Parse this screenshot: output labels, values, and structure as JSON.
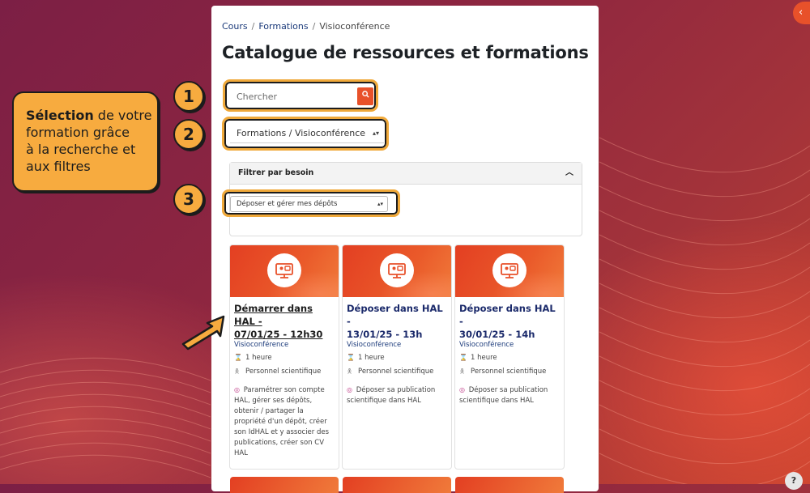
{
  "breadcrumb": {
    "items": [
      "Cours",
      "Formations",
      "Visioconférence"
    ]
  },
  "page_title": "Catalogue de ressources et formations",
  "search": {
    "placeholder": "Chercher",
    "button_icon": "search-icon"
  },
  "category_select": {
    "value": "Formations / Visioconférence"
  },
  "filter": {
    "header": "Filtrer par besoin",
    "selected": "Déposer et gérer mes dépôts"
  },
  "callout": {
    "bold": "Sélection",
    "line1_rest": " de votre",
    "line2": "formation grâce",
    "line3": "à la recherche et",
    "line4": "aux filtres"
  },
  "steps": [
    "1",
    "2",
    "3"
  ],
  "cards": [
    {
      "title_line1": "Démarrer dans HAL -",
      "title_line2": "07/01/25 - 12h30",
      "category": "Visioconférence",
      "duration": "1 heure",
      "audience": "Personnel scientifique",
      "description": "Paramétrer son compte HAL, gérer ses dépôts, obtenir / partager la propriété d'un dépôt, créer son IdHAL et y associer des publications, créer son CV HAL"
    },
    {
      "title_line1": "Déposer dans HAL -",
      "title_line2": "13/01/25 - 13h",
      "category": "Visioconférence",
      "duration": "1 heure",
      "audience": "Personnel scientifique",
      "description": "Déposer sa publication scientifique dans HAL"
    },
    {
      "title_line1": "Déposer dans HAL -",
      "title_line2": "30/01/25 - 14h",
      "category": "Visioconférence",
      "duration": "1 heure",
      "audience": "Personnel scientifique",
      "description": "Déposer sa publication scientifique dans HAL"
    }
  ],
  "side_toggle_icon": "chevron-left-icon",
  "help_label": "?",
  "colors": {
    "accent": "#e8512a",
    "callout": "#f7ab3f",
    "link": "#1b3a7a"
  }
}
